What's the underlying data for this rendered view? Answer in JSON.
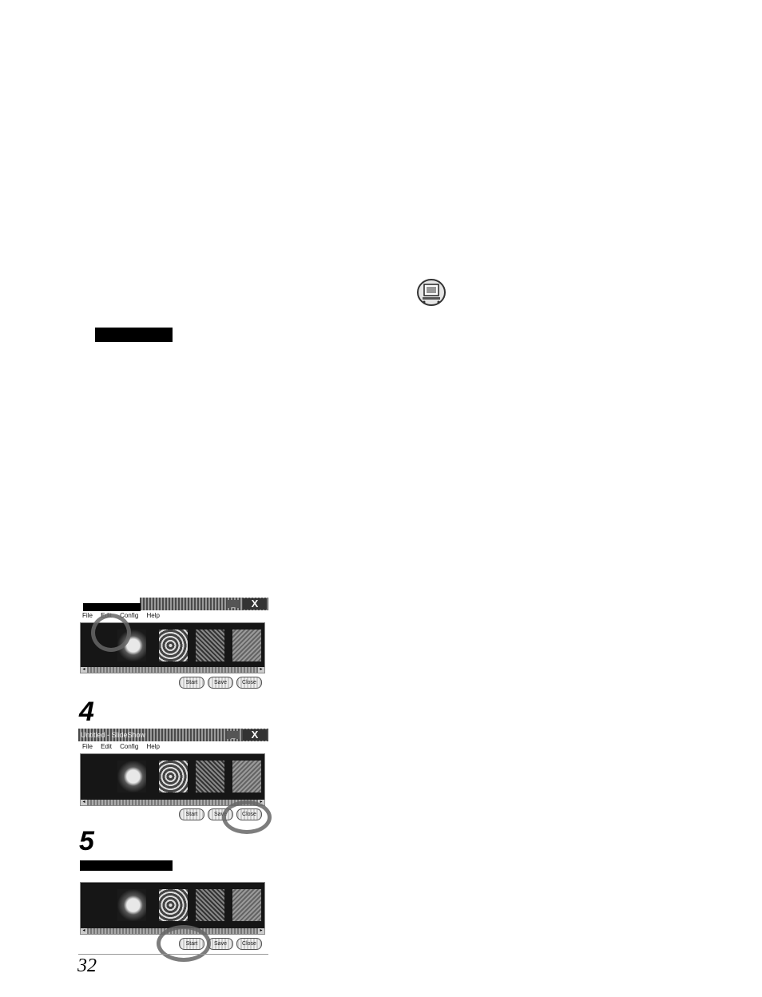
{
  "page_number": "32",
  "steps": {
    "step4": "4",
    "step5": "5"
  },
  "screenshot1": {
    "menu": [
      "File",
      "Edit",
      "Config",
      "Help"
    ],
    "window_controls": {
      "minimize": "_",
      "close": "X"
    },
    "buttons": [
      "Start",
      "Save",
      "Close"
    ]
  },
  "screenshot2": {
    "title": "Untitled - SlideShow",
    "menu": [
      "File",
      "Edit",
      "Config",
      "Help"
    ],
    "window_controls": {
      "minimize": "_",
      "close": "X"
    },
    "buttons": [
      "Start",
      "Save",
      "Close"
    ]
  },
  "screenshot3": {
    "buttons": [
      "Start",
      "Save",
      "Close"
    ]
  },
  "icons": {
    "app_icon": "slideshow-app-icon",
    "scroll_left": "arrow-left-icon",
    "scroll_right": "arrow-right-icon"
  }
}
